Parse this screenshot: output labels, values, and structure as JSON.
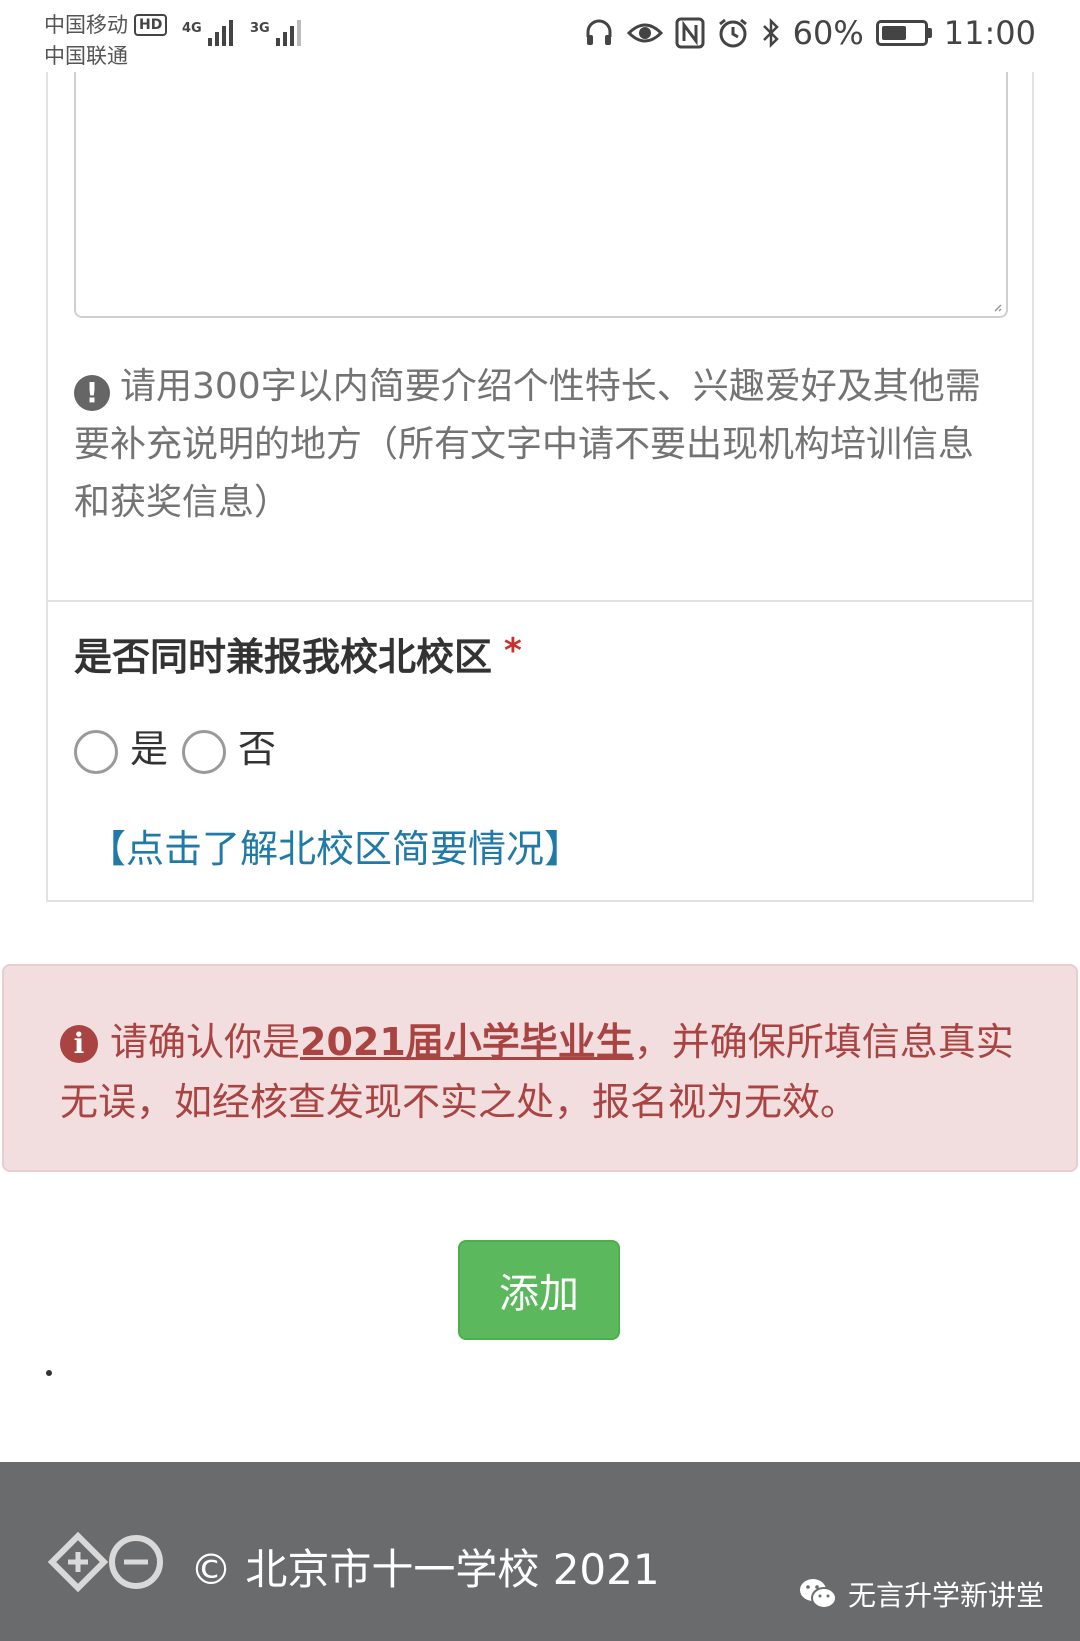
{
  "status_bar": {
    "carrier_1": "中国移动",
    "carrier_1_badge": "HD",
    "carrier_2": "中国联通",
    "signal_1_label": "4G",
    "signal_2_label": "3G",
    "battery": "60%",
    "time": "11:00"
  },
  "form": {
    "help_icon": "!",
    "help_text": "请用300字以内简要介绍个性特长、兴趣爱好及其他需要补充说明的地方（所有文字中请不要出现机构培训信息和获奖信息）",
    "question_label": "是否同时兼报我校北校区",
    "required_mark": "*",
    "options": [
      {
        "label": "是"
      },
      {
        "label": "否"
      }
    ],
    "info_link": "【点击了解北校区简要情况】"
  },
  "alert": {
    "icon": "i",
    "text_before": "请确认你是",
    "text_emphasis": "2021届小学毕业生",
    "text_after": "，并确保所填信息真实无误，如经核查发现不实之处，报名视为无效。"
  },
  "actions": {
    "add_button": "添加"
  },
  "footer": {
    "copyright": "© 北京市十一学校 2021",
    "watermark": "无言升学新讲堂"
  },
  "colors": {
    "alert_bg": "#f2dede",
    "alert_text": "#a94442",
    "button_green": "#5cb85c",
    "link_blue": "#1f7aa8",
    "footer_bg": "#6a6b6d"
  }
}
